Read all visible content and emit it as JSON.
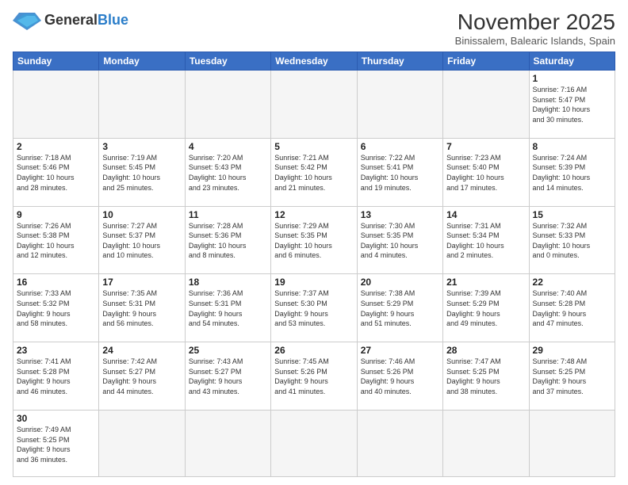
{
  "header": {
    "logo_general": "General",
    "logo_blue": "Blue",
    "month_year": "November 2025",
    "location": "Binissalem, Balearic Islands, Spain"
  },
  "weekdays": [
    "Sunday",
    "Monday",
    "Tuesday",
    "Wednesday",
    "Thursday",
    "Friday",
    "Saturday"
  ],
  "weeks": [
    [
      {
        "day": "",
        "info": ""
      },
      {
        "day": "",
        "info": ""
      },
      {
        "day": "",
        "info": ""
      },
      {
        "day": "",
        "info": ""
      },
      {
        "day": "",
        "info": ""
      },
      {
        "day": "",
        "info": ""
      },
      {
        "day": "1",
        "info": "Sunrise: 7:16 AM\nSunset: 5:47 PM\nDaylight: 10 hours\nand 30 minutes."
      }
    ],
    [
      {
        "day": "2",
        "info": "Sunrise: 7:18 AM\nSunset: 5:46 PM\nDaylight: 10 hours\nand 28 minutes."
      },
      {
        "day": "3",
        "info": "Sunrise: 7:19 AM\nSunset: 5:45 PM\nDaylight: 10 hours\nand 25 minutes."
      },
      {
        "day": "4",
        "info": "Sunrise: 7:20 AM\nSunset: 5:43 PM\nDaylight: 10 hours\nand 23 minutes."
      },
      {
        "day": "5",
        "info": "Sunrise: 7:21 AM\nSunset: 5:42 PM\nDaylight: 10 hours\nand 21 minutes."
      },
      {
        "day": "6",
        "info": "Sunrise: 7:22 AM\nSunset: 5:41 PM\nDaylight: 10 hours\nand 19 minutes."
      },
      {
        "day": "7",
        "info": "Sunrise: 7:23 AM\nSunset: 5:40 PM\nDaylight: 10 hours\nand 17 minutes."
      },
      {
        "day": "8",
        "info": "Sunrise: 7:24 AM\nSunset: 5:39 PM\nDaylight: 10 hours\nand 14 minutes."
      }
    ],
    [
      {
        "day": "9",
        "info": "Sunrise: 7:26 AM\nSunset: 5:38 PM\nDaylight: 10 hours\nand 12 minutes."
      },
      {
        "day": "10",
        "info": "Sunrise: 7:27 AM\nSunset: 5:37 PM\nDaylight: 10 hours\nand 10 minutes."
      },
      {
        "day": "11",
        "info": "Sunrise: 7:28 AM\nSunset: 5:36 PM\nDaylight: 10 hours\nand 8 minutes."
      },
      {
        "day": "12",
        "info": "Sunrise: 7:29 AM\nSunset: 5:35 PM\nDaylight: 10 hours\nand 6 minutes."
      },
      {
        "day": "13",
        "info": "Sunrise: 7:30 AM\nSunset: 5:35 PM\nDaylight: 10 hours\nand 4 minutes."
      },
      {
        "day": "14",
        "info": "Sunrise: 7:31 AM\nSunset: 5:34 PM\nDaylight: 10 hours\nand 2 minutes."
      },
      {
        "day": "15",
        "info": "Sunrise: 7:32 AM\nSunset: 5:33 PM\nDaylight: 10 hours\nand 0 minutes."
      }
    ],
    [
      {
        "day": "16",
        "info": "Sunrise: 7:33 AM\nSunset: 5:32 PM\nDaylight: 9 hours\nand 58 minutes."
      },
      {
        "day": "17",
        "info": "Sunrise: 7:35 AM\nSunset: 5:31 PM\nDaylight: 9 hours\nand 56 minutes."
      },
      {
        "day": "18",
        "info": "Sunrise: 7:36 AM\nSunset: 5:31 PM\nDaylight: 9 hours\nand 54 minutes."
      },
      {
        "day": "19",
        "info": "Sunrise: 7:37 AM\nSunset: 5:30 PM\nDaylight: 9 hours\nand 53 minutes."
      },
      {
        "day": "20",
        "info": "Sunrise: 7:38 AM\nSunset: 5:29 PM\nDaylight: 9 hours\nand 51 minutes."
      },
      {
        "day": "21",
        "info": "Sunrise: 7:39 AM\nSunset: 5:29 PM\nDaylight: 9 hours\nand 49 minutes."
      },
      {
        "day": "22",
        "info": "Sunrise: 7:40 AM\nSunset: 5:28 PM\nDaylight: 9 hours\nand 47 minutes."
      }
    ],
    [
      {
        "day": "23",
        "info": "Sunrise: 7:41 AM\nSunset: 5:28 PM\nDaylight: 9 hours\nand 46 minutes."
      },
      {
        "day": "24",
        "info": "Sunrise: 7:42 AM\nSunset: 5:27 PM\nDaylight: 9 hours\nand 44 minutes."
      },
      {
        "day": "25",
        "info": "Sunrise: 7:43 AM\nSunset: 5:27 PM\nDaylight: 9 hours\nand 43 minutes."
      },
      {
        "day": "26",
        "info": "Sunrise: 7:45 AM\nSunset: 5:26 PM\nDaylight: 9 hours\nand 41 minutes."
      },
      {
        "day": "27",
        "info": "Sunrise: 7:46 AM\nSunset: 5:26 PM\nDaylight: 9 hours\nand 40 minutes."
      },
      {
        "day": "28",
        "info": "Sunrise: 7:47 AM\nSunset: 5:25 PM\nDaylight: 9 hours\nand 38 minutes."
      },
      {
        "day": "29",
        "info": "Sunrise: 7:48 AM\nSunset: 5:25 PM\nDaylight: 9 hours\nand 37 minutes."
      }
    ],
    [
      {
        "day": "30",
        "info": "Sunrise: 7:49 AM\nSunset: 5:25 PM\nDaylight: 9 hours\nand 36 minutes."
      },
      {
        "day": "",
        "info": ""
      },
      {
        "day": "",
        "info": ""
      },
      {
        "day": "",
        "info": ""
      },
      {
        "day": "",
        "info": ""
      },
      {
        "day": "",
        "info": ""
      },
      {
        "day": "",
        "info": ""
      }
    ]
  ]
}
